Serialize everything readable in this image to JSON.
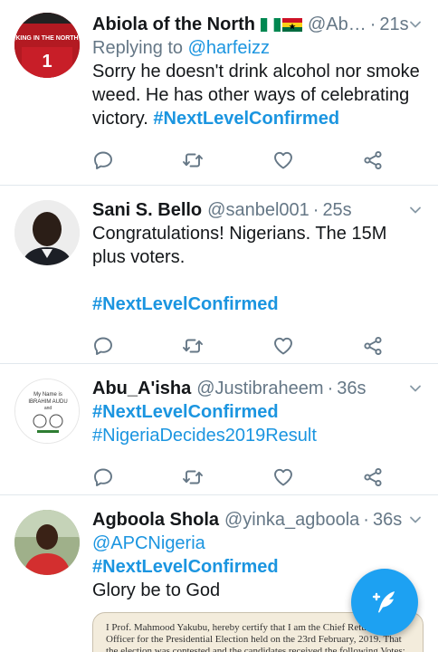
{
  "colors": {
    "accent": "#1b95e0",
    "fab": "#1da1f2",
    "secondary": "#657786"
  },
  "tweets": [
    {
      "name": "Abiola of the North",
      "handle": "@Ab…",
      "time": "21s",
      "reply_prefix": "Replying to",
      "reply_to": "@harfeizz",
      "text": "Sorry he doesn't drink alcohol nor smoke weed. He has other ways of celebrating victory.",
      "hashtag": "#NextLevelConfirmed",
      "avatar_text": "KING IN THE NORTH",
      "avatar_number": "1"
    },
    {
      "name": "Sani S. Bello",
      "handle": "@sanbel001",
      "time": "25s",
      "text": "Congratulations! Nigerians. The 15M plus voters.",
      "hashtag": "#NextLevelConfirmed"
    },
    {
      "name": "Abu_A'isha",
      "handle": "@Justibraheem",
      "time": "36s",
      "hashtag1": "#NextLevelConfirmed",
      "hashtag2": "#NigeriaDecides2019Result",
      "avatar_line1": "My Name is",
      "avatar_line2": "IBRAHIM AUDU",
      "avatar_line3": "and"
    },
    {
      "name": "Agboola Shola",
      "handle": "@yinka_agboola",
      "time": "36s",
      "mention": "@APCNigeria",
      "hashtag": "#NextLevelConfirmed",
      "text": "Glory be to God",
      "preview_text": "I Prof. Mahmood Yakubu, hereby certify that I am the Chief Returnung Officer for the Presidential Election held on the 23rd February, 2019. That the election was contested and the candidates received the following Votes;"
    }
  ],
  "separator": "·",
  "icons": {
    "reply": "reply-icon",
    "retweet": "retweet-icon",
    "like": "heart-icon",
    "share": "share-icon",
    "caret": "chevron-down-icon",
    "compose": "compose-icon"
  }
}
